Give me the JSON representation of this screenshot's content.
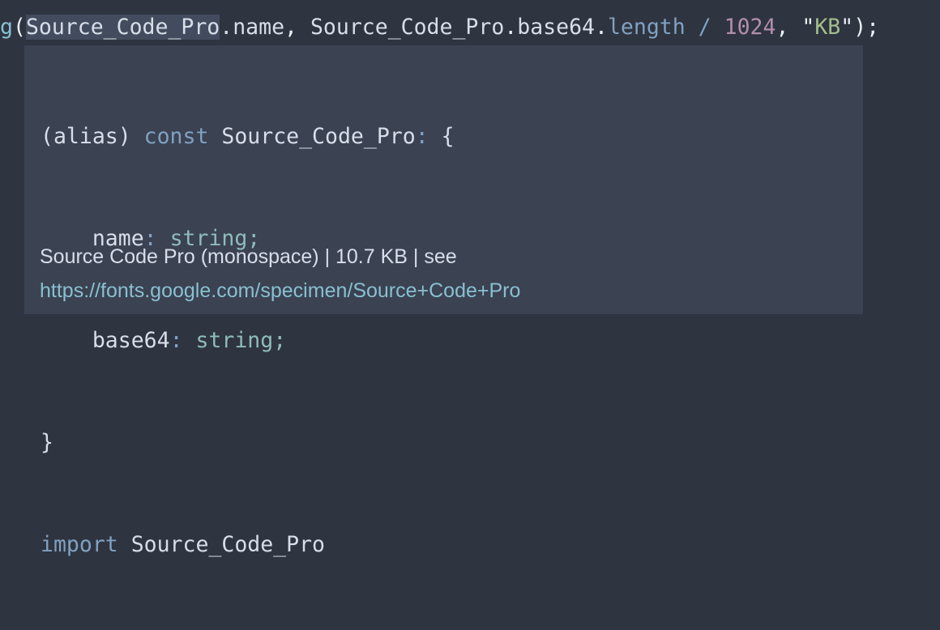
{
  "editor": {
    "code_line": {
      "fn_fragment": "g",
      "paren_open": "(",
      "arg1_highlighted": "Source_Code_Pro",
      "arg1_rest": ".name",
      "sep1": ", ",
      "arg2_object": "Source_Code_Pro",
      "arg2_dot1": ".",
      "arg2_prop1": "base64",
      "arg2_dot2": ".",
      "arg2_prop2": "length",
      "op_space1": " ",
      "op_div": "/",
      "op_space2": " ",
      "number": "1024",
      "sep2": ", ",
      "quote_open": "\"",
      "string_val": "KB",
      "quote_close": "\"",
      "paren_close": ");"
    }
  },
  "hover": {
    "signature": {
      "line1_alias": "(alias) ",
      "line1_kw": "const",
      "line1_name": " Source_Code_Pro",
      "line1_colon": ":",
      "line1_brace": " {",
      "line2_indent": "    ",
      "line2_prop": "name",
      "line2_colon": ":",
      "line2_type": " string;",
      "line3_indent": "    ",
      "line3_prop": "base64",
      "line3_colon": ":",
      "line3_type": " string;",
      "line4_brace": "}",
      "line5_kw": "import",
      "line5_name": " Source_Code_Pro"
    },
    "doc": {
      "description": "Source Code Pro (monospace) | 10.7 KB | see",
      "link": "https://fonts.google.com/specimen/Source+Code+Pro"
    }
  },
  "colors": {
    "editor_background": "#2e3440",
    "popup_background": "#3b4252",
    "keyword": "#81a1c1",
    "type": "#8fbcbb",
    "link": "#88c0d0",
    "number": "#b48ead",
    "string": "#a3be8c"
  }
}
